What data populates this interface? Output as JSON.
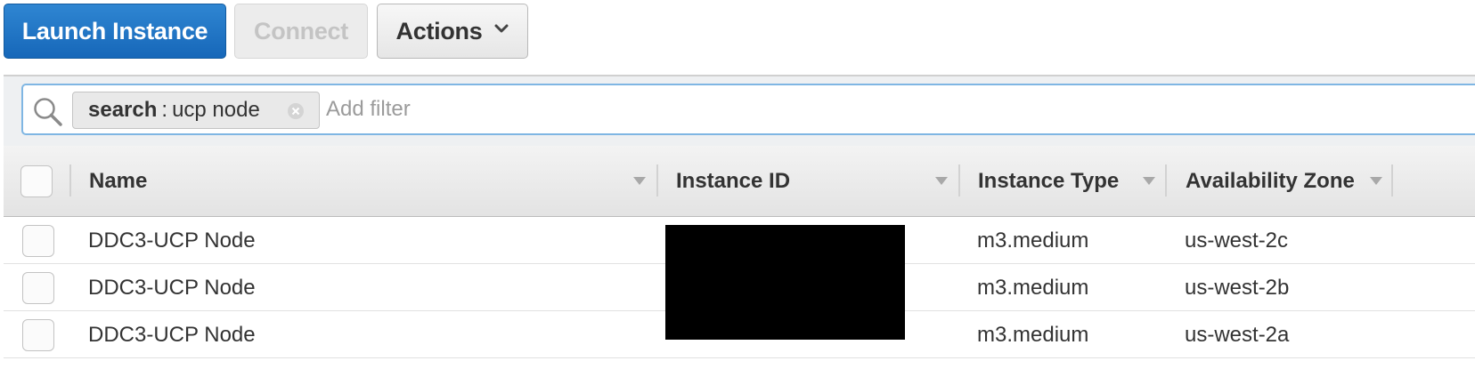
{
  "toolbar": {
    "launch_label": "Launch Instance",
    "connect_label": "Connect",
    "actions_label": "Actions"
  },
  "filter": {
    "token_key": "search",
    "token_sep": ":",
    "token_value": "ucp node",
    "add_filter_placeholder": "Add filter"
  },
  "table": {
    "columns": [
      {
        "label": "Name"
      },
      {
        "label": "Instance ID"
      },
      {
        "label": "Instance Type"
      },
      {
        "label": "Availability Zone"
      }
    ],
    "rows": [
      {
        "name": "DDC3-UCP Node",
        "instance_type": "m3.medium",
        "availability_zone": "us-west-2c"
      },
      {
        "name": "DDC3-UCP Node",
        "instance_type": "m3.medium",
        "availability_zone": "us-west-2b"
      },
      {
        "name": "DDC3-UCP Node",
        "instance_type": "m3.medium",
        "availability_zone": "us-west-2a"
      }
    ]
  },
  "colors": {
    "primary": "#1a6fc1",
    "filter_border": "#7fb6e3"
  },
  "icons": {
    "search": "search-icon",
    "token_remove": "close-circle-icon",
    "actions_dropdown": "chevron-down-icon",
    "sort": "sort-caret-icon"
  }
}
